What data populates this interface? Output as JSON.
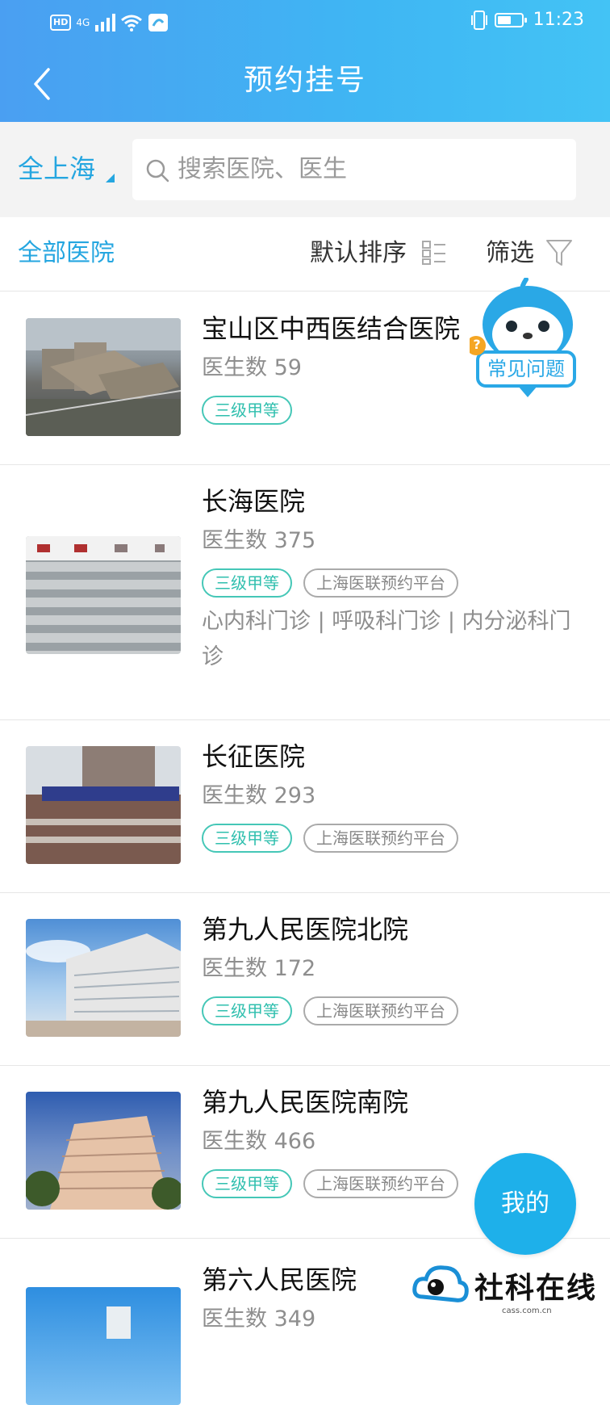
{
  "status_bar": {
    "hd": "HD",
    "network": "4G",
    "time": "11:23"
  },
  "nav": {
    "title": "预约挂号"
  },
  "search": {
    "city": "全上海",
    "placeholder": "搜索医院、医生"
  },
  "filter": {
    "all": "全部医院",
    "sort": "默认排序",
    "screen": "筛选"
  },
  "hospitals": [
    {
      "name": "宝山区中西医结合医院",
      "count": "医生数 59",
      "level": "三级甲等",
      "platform": "",
      "depts": ""
    },
    {
      "name": "长海医院",
      "count": "医生数 375",
      "level": "三级甲等",
      "platform": "上海医联预约平台",
      "depts": "心内科门诊 | 呼吸科门诊 | 内分泌科门诊"
    },
    {
      "name": "长征医院",
      "count": "医生数 293",
      "level": "三级甲等",
      "platform": "上海医联预约平台",
      "depts": ""
    },
    {
      "name": "第九人民医院北院",
      "count": "医生数 172",
      "level": "三级甲等",
      "platform": "上海医联预约平台",
      "depts": ""
    },
    {
      "name": "第九人民医院南院",
      "count": "医生数 466",
      "level": "三级甲等",
      "platform": "上海医联预约平台",
      "depts": ""
    },
    {
      "name": "第六人民医院",
      "count": "医生数 349",
      "level": "",
      "platform": "",
      "depts": ""
    }
  ],
  "faq": {
    "label": "常见问题",
    "mark": "?"
  },
  "fab": {
    "label": "我的"
  },
  "watermark": {
    "text": "社科在线",
    "sub": "cass.com.cn"
  },
  "colors": {
    "accent": "#25a6e0",
    "tag_green": "#45c7b7",
    "fab": "#1eb0ea"
  }
}
